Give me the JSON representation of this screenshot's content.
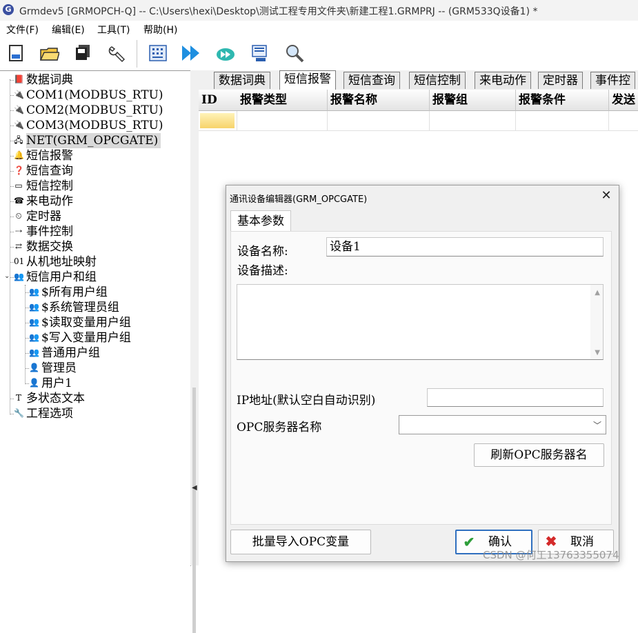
{
  "window": {
    "title": "Grmdev5 [GRMOPCH-Q]  -- C:\\Users\\hexi\\Desktop\\测试工程专用文件夹\\新建工程1.GRMPRJ -- (GRM533Q设备1) *"
  },
  "menu": {
    "items": [
      "文件(F)",
      "编辑(E)",
      "工具(T)",
      "帮助(H)"
    ]
  },
  "tree": {
    "items": [
      {
        "label": "数据词典",
        "icon": "book-icon"
      },
      {
        "label": "COM1(MODBUS_RTU)",
        "icon": "plug-icon"
      },
      {
        "label": "COM2(MODBUS_RTU)",
        "icon": "plug-icon"
      },
      {
        "label": "COM3(MODBUS_RTU)",
        "icon": "plug-icon"
      },
      {
        "label": "NET(GRM_OPCGATE)",
        "icon": "network-icon"
      },
      {
        "label": "短信报警",
        "icon": "bell-icon"
      },
      {
        "label": "短信查询",
        "icon": "query-icon"
      },
      {
        "label": "短信控制",
        "icon": "cmd-icon"
      },
      {
        "label": "来电动作",
        "icon": "phone-icon"
      },
      {
        "label": "定时器",
        "icon": "timer-icon"
      },
      {
        "label": "事件控制",
        "icon": "event-icon"
      },
      {
        "label": "数据交换",
        "icon": "exchange-icon"
      },
      {
        "label": "从机地址映射",
        "icon": "binary-icon"
      },
      {
        "label": "短信用户和组",
        "icon": "group-icon"
      },
      {
        "label": "$所有用户组",
        "icon": "group-icon"
      },
      {
        "label": "$系统管理员组",
        "icon": "group-icon"
      },
      {
        "label": "$读取变量用户组",
        "icon": "group-icon"
      },
      {
        "label": "$写入变量用户组",
        "icon": "group-icon"
      },
      {
        "label": "普通用户组",
        "icon": "group-icon"
      },
      {
        "label": "管理员",
        "icon": "user-icon"
      },
      {
        "label": "用户1",
        "icon": "user-icon"
      },
      {
        "label": "多状态文本",
        "icon": "text-icon"
      },
      {
        "label": "工程选项",
        "icon": "wrench-icon"
      }
    ],
    "selected_index": 4
  },
  "tabs": [
    "数据词典",
    "短信报警",
    "短信查询",
    "短信控制",
    "来电动作",
    "定时器",
    "事件控"
  ],
  "active_tab": 1,
  "grid": {
    "columns": [
      "ID",
      "报警类型",
      "报警名称",
      "报警组",
      "报警条件",
      "发送"
    ]
  },
  "dialog": {
    "title": "通讯设备编辑器(GRM_OPCGATE)",
    "tab": "基本参数",
    "device_name_label": "设备名称:",
    "device_name_value": "设备1",
    "device_desc_label": "设备描述:",
    "ip_label": "IP地址(默认空白自动识别)",
    "ip_value": "",
    "opc_label": "OPC服务器名称",
    "opc_value": "",
    "refresh_button": "刷新OPC服务器名",
    "import_button": "批量导入OPC变量",
    "ok_button": "确认",
    "cancel_button": "取消"
  },
  "watermark": "CSDN @何工13763355074",
  "colors": {
    "selection_yellow": "#f7d36a",
    "primary_border": "#2f6fbf",
    "ok_check": "#2e9e3a",
    "cancel_x": "#d42a2a"
  }
}
